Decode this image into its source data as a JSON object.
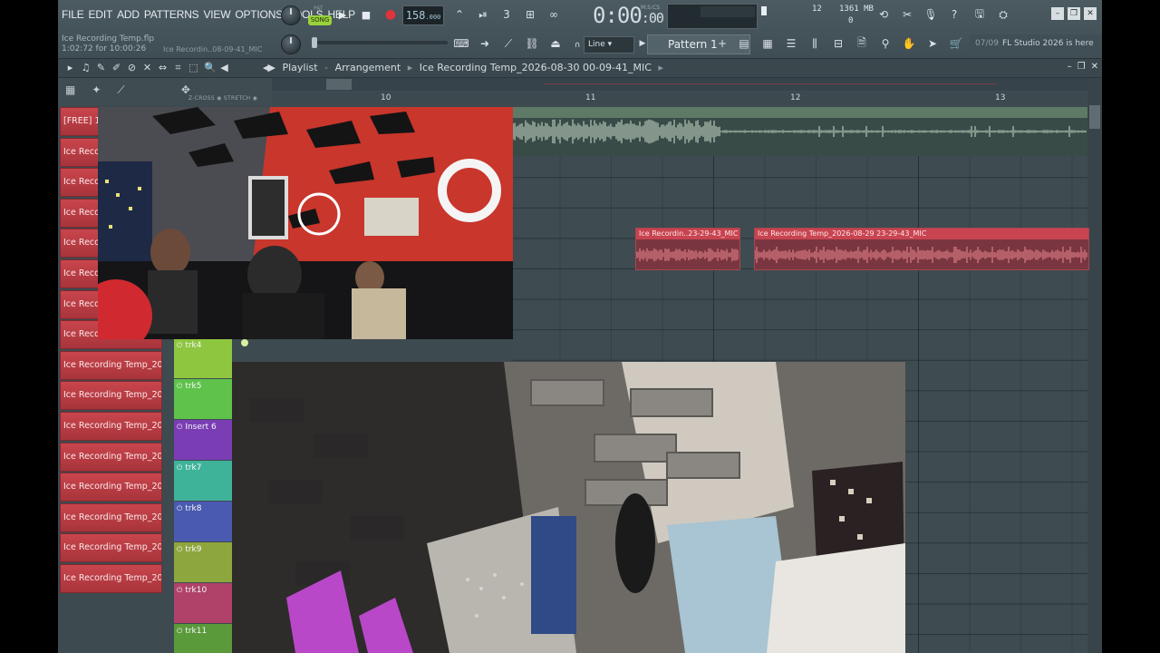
{
  "menu": [
    "FILE",
    "EDIT",
    "ADD",
    "PATTERNS",
    "VIEW",
    "OPTIONS",
    "TOOLS",
    "HELP"
  ],
  "transport": {
    "pat_label": "PAT",
    "song_label": "SONG",
    "tempo": "158",
    "tempo_frac": ".000",
    "time_main": "0:00",
    "time_sub": ":00",
    "time_units": "M:S:CS"
  },
  "cpu": {
    "voices": "12",
    "memory": "1361 MB",
    "zero": "0"
  },
  "hint": {
    "file": "Ice Recording Temp.flp",
    "time": "1:02:72 for 10:00:26",
    "recording": "Ice Recordin..08-09-41_MIC"
  },
  "snap": "Line",
  "pattern": "Pattern 1",
  "news": {
    "date": "07/09",
    "text": "FL Studio 2026 is here"
  },
  "playlist": {
    "title": "Playlist",
    "view": "Arrangement",
    "project": "Ice Recording Temp_2026-08-30 00-09-41_MIC",
    "zlabels": "Z-CROSS ◉  STRETCH ◉"
  },
  "ruler": [
    "10",
    "11",
    "12",
    "13"
  ],
  "tracks": [
    "[FREE] 19",
    "Ice Recor",
    "Ice Recor",
    "Ice Recor",
    "Ice Recor",
    "Ice Recor",
    "Ice Recor",
    "Ice Recor",
    "Ice Recording Temp_202...",
    "Ice Recording Temp_202...",
    "Ice Recording Temp_202...",
    "Ice Recording Temp_202...",
    "Ice Recording Temp_202...",
    "Ice Recording Temp_202...",
    "Ice Recording Temp_202...",
    "Ice Recording Temp_202..."
  ],
  "inserts": [
    {
      "label": "trk4",
      "color": "#8ec63f"
    },
    {
      "label": "trk5",
      "color": "#5fc24a"
    },
    {
      "label": "Insert 6",
      "color": "#7a3db4"
    },
    {
      "label": "trk7",
      "color": "#3fb39a"
    },
    {
      "label": "trk8",
      "color": "#4a5ab0"
    },
    {
      "label": "trk9",
      "color": "#8ea63e"
    },
    {
      "label": "trk10",
      "color": "#b0426a"
    },
    {
      "label": "trk11",
      "color": "#5a9a3a"
    }
  ],
  "clips": {
    "short": "Ice Recordin..23-29-43_MIC",
    "long": "Ice Recording Temp_2026-08-29 23-29-43_MIC"
  },
  "colors": {
    "accent_song": "#9ad33b",
    "record": "#e0343b",
    "track_red": "#c9454d"
  }
}
